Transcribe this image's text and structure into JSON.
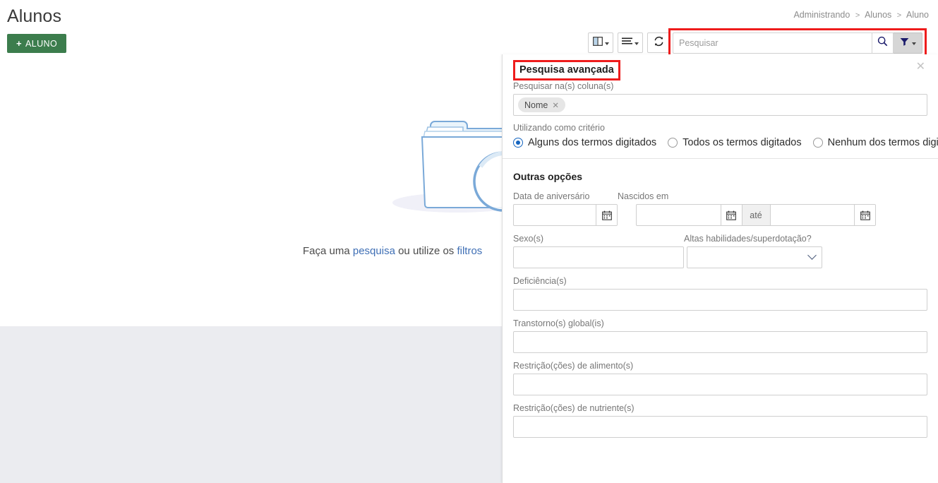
{
  "page": {
    "title": "Alunos",
    "add_button": "ALUNO",
    "add_button_icon": "plus-icon"
  },
  "breadcrumb": {
    "items": [
      "Administrando",
      "Alunos",
      "Aluno"
    ],
    "separator": ">"
  },
  "toolbar": {
    "columns_button_icon": "columns-toggle-icon",
    "density_button_icon": "list-density-icon",
    "refresh_button_icon": "refresh-icon"
  },
  "search": {
    "placeholder": "Pesquisar",
    "value": "",
    "search_icon": "magnifier-icon",
    "filter_icon": "funnel-icon",
    "highlight_color": "#ee1c1c"
  },
  "empty_state": {
    "illustration": "empty-folder-with-magnifier",
    "text_before": "Faça uma ",
    "link_search": "pesquisa",
    "text_middle": " ou utilize os ",
    "link_filters": "filtros"
  },
  "panel": {
    "title": "Pesquisa avançada",
    "close_icon": "close-icon",
    "columns_label": "Pesquisar na(s) coluna(s)",
    "columns_tags": [
      {
        "label": "Nome",
        "remove_icon": "remove-tag-icon"
      }
    ],
    "criteria_label": "Utilizando como critério",
    "criteria_options": [
      {
        "label": "Alguns dos termos digitados",
        "selected": true
      },
      {
        "label": "Todos os termos digitados",
        "selected": false
      },
      {
        "label": "Nenhum dos termos digitados",
        "selected": false
      }
    ],
    "other_options_title": "Outras opções",
    "fields": {
      "birthday_label": "Data de aniversário",
      "birthday_value": "",
      "born_in_label": "Nascidos em",
      "born_from_value": "",
      "born_until_label": "até",
      "born_to_value": "",
      "calendar_icon": "calendar-icon",
      "sex_label": "Sexo(s)",
      "sex_value": "",
      "giftedness_label": "Altas habilidades/superdotação?",
      "giftedness_value": "",
      "giftedness_chevron": "chevron-down-icon",
      "disability_label": "Deficiência(s)",
      "disability_value": "",
      "global_disorder_label": "Transtorno(s) global(is)",
      "global_disorder_value": "",
      "food_restriction_label": "Restrição(ções) de alimento(s)",
      "food_restriction_value": "",
      "nutrient_restriction_label": "Restrição(ções) de nutriente(s)",
      "nutrient_restriction_value": ""
    }
  },
  "colors": {
    "primary_green": "#3c7d4d",
    "link_blue": "#3f6fb5",
    "radio_blue": "#1565c0",
    "gray_strip": "#ebecf0"
  }
}
